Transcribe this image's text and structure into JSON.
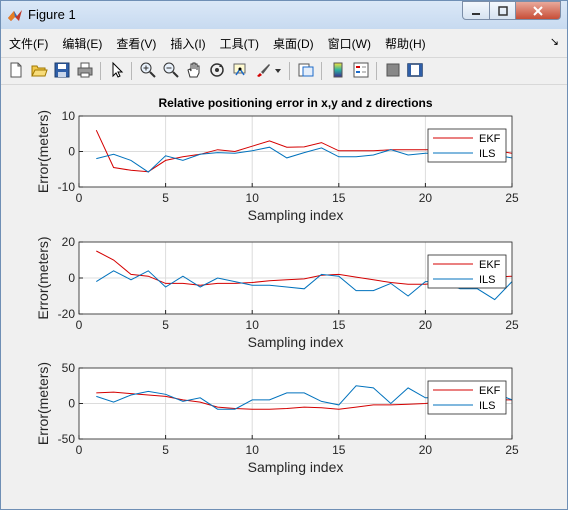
{
  "window": {
    "title": "Figure 1"
  },
  "menu": [
    "文件(F)",
    "编辑(E)",
    "查看(V)",
    "插入(I)",
    "工具(T)",
    "桌面(D)",
    "窗口(W)",
    "帮助(H)"
  ],
  "toolbar_icons": [
    "new-figure-icon",
    "open-folder-icon",
    "save-icon",
    "print-icon",
    "pointer-icon",
    "zoom-in-icon",
    "zoom-out-icon",
    "pan-hand-icon",
    "rotate-3d-icon",
    "data-cursor-icon",
    "brush-icon",
    "link-plot-icon",
    "colorbar-icon",
    "legend-icon",
    "hide-plot-tools-icon",
    "show-plot-tools-icon"
  ],
  "colors": {
    "ekf": "#d40000",
    "ils": "#0072bd"
  },
  "chart_data": [
    {
      "type": "line",
      "title": "Relative positioning error in x,y and z directions",
      "xlabel": "Sampling index",
      "ylabel": "Error(meters)",
      "xlim": [
        0,
        25
      ],
      "ylim": [
        -10,
        10
      ],
      "xticks": [
        0,
        5,
        10,
        15,
        20,
        25
      ],
      "yticks": [
        -10,
        0,
        10
      ],
      "grid": true,
      "legend_position": "top-right",
      "x": [
        1,
        2,
        3,
        4,
        5,
        6,
        7,
        8,
        9,
        10,
        11,
        12,
        13,
        14,
        15,
        16,
        17,
        18,
        19,
        20,
        21,
        22,
        23,
        24,
        25
      ],
      "series": [
        {
          "name": "EKF",
          "values": [
            6,
            -4.5,
            -5.3,
            -5.7,
            -2.5,
            -1.5,
            -0.8,
            0.5,
            0,
            1.5,
            3,
            1.2,
            1.3,
            2.5,
            0.2,
            0.2,
            0.2,
            0.5,
            0.5,
            0.5,
            0.5,
            0.5,
            0.5,
            0.3,
            -0.5
          ]
        },
        {
          "name": "ILS",
          "values": [
            -2,
            -0.8,
            -2.5,
            -5.8,
            -1.2,
            -2.5,
            -0.8,
            -0.3,
            -0.5,
            0.2,
            1.2,
            -1.8,
            -0.3,
            1,
            -1.5,
            -1.5,
            -1,
            0.5,
            -1,
            -0.5,
            -0.5,
            -1,
            -0.5,
            -1,
            -1.8
          ]
        }
      ]
    },
    {
      "type": "line",
      "title": "",
      "xlabel": "Sampling index",
      "ylabel": "Error(meters)",
      "xlim": [
        0,
        25
      ],
      "ylim": [
        -20,
        20
      ],
      "xticks": [
        0,
        5,
        10,
        15,
        20,
        25
      ],
      "yticks": [
        -20,
        0,
        20
      ],
      "grid": true,
      "legend_position": "top-right",
      "x": [
        1,
        2,
        3,
        4,
        5,
        6,
        7,
        8,
        9,
        10,
        11,
        12,
        13,
        14,
        15,
        16,
        17,
        18,
        19,
        20,
        21,
        22,
        23,
        24,
        25
      ],
      "series": [
        {
          "name": "EKF",
          "values": [
            15,
            10,
            2,
            1,
            -3,
            -3,
            -4,
            -3,
            -3,
            -2.5,
            -1.5,
            -1,
            -0.5,
            1.5,
            2,
            0.5,
            -1,
            -2.5,
            -3.5,
            -3.5,
            -2.5,
            -1.5,
            -1,
            0.5,
            1
          ]
        },
        {
          "name": "ILS",
          "values": [
            -2,
            4,
            -1,
            4,
            -5,
            1,
            -5,
            0,
            -2,
            -4,
            -4,
            -5,
            -6,
            2,
            1,
            -7,
            -7,
            -3,
            -10,
            -2,
            -2,
            -6,
            -6,
            -12,
            -2
          ]
        }
      ]
    },
    {
      "type": "line",
      "title": "",
      "xlabel": "Sampling index",
      "ylabel": "Error(meters)",
      "xlim": [
        0,
        25
      ],
      "ylim": [
        -50,
        50
      ],
      "xticks": [
        0,
        5,
        10,
        15,
        20,
        25
      ],
      "yticks": [
        -50,
        0,
        50
      ],
      "grid": true,
      "legend_position": "top-right",
      "x": [
        1,
        2,
        3,
        4,
        5,
        6,
        7,
        8,
        9,
        10,
        11,
        12,
        13,
        14,
        15,
        16,
        17,
        18,
        19,
        20,
        21,
        22,
        23,
        24,
        25
      ],
      "series": [
        {
          "name": "EKF",
          "values": [
            15,
            16,
            14,
            12,
            10,
            5,
            2,
            -5,
            -7,
            -8,
            -8,
            -7,
            -5,
            -6,
            -8,
            -5,
            -2,
            -2,
            -1,
            0,
            3,
            5,
            5,
            5,
            5
          ]
        },
        {
          "name": "ILS",
          "values": [
            10,
            2,
            12,
            17,
            13,
            3,
            8,
            -8,
            -8,
            5,
            5,
            15,
            15,
            3,
            -2,
            25,
            22,
            0,
            22,
            8,
            8,
            5,
            25,
            15,
            5
          ]
        }
      ]
    }
  ]
}
